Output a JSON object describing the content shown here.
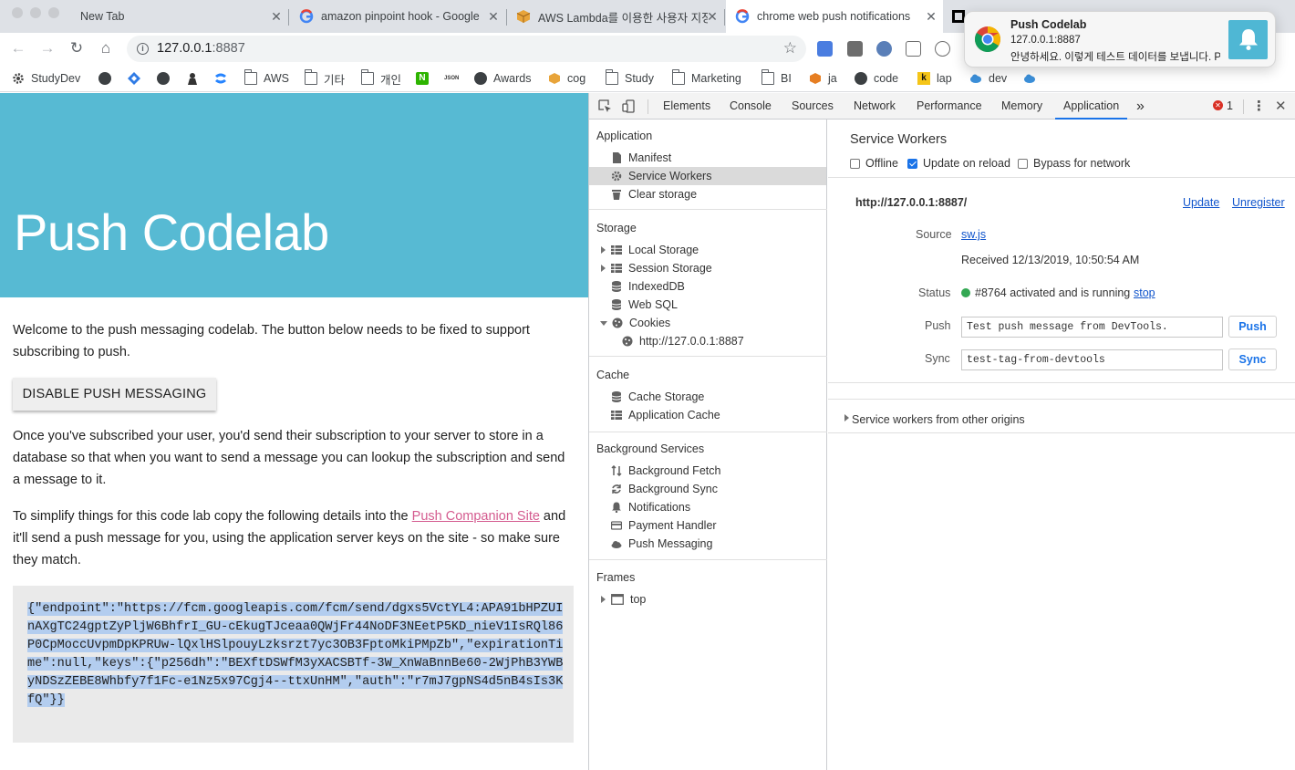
{
  "tabs": [
    {
      "title": "New Tab"
    },
    {
      "title": "amazon pinpoint hook - Google"
    },
    {
      "title": "AWS Lambda를 이용한 사용자 지정"
    },
    {
      "title": "chrome web push notifications"
    }
  ],
  "toolbar": {
    "url_host": "127.0.0.1",
    "url_port": ":8887"
  },
  "bookmarks": [
    {
      "label": "StudyDev"
    },
    {
      "label": "AWS"
    },
    {
      "label": "기타"
    },
    {
      "label": "개인"
    },
    {
      "label": "Awards"
    },
    {
      "label": "cog"
    },
    {
      "label": "Study"
    },
    {
      "label": "Marketing"
    },
    {
      "label": "BI"
    },
    {
      "label": "ja"
    },
    {
      "label": "code"
    },
    {
      "label": "lap"
    },
    {
      "label": "dev"
    }
  ],
  "bookmark_icon_text": {
    "n": "N",
    "json": "JSON",
    "k": "k"
  },
  "page": {
    "title": "Push Codelab",
    "intro": "Welcome to the push messaging codelab. The button below needs to be fixed to support subscribing to push.",
    "button_label": "DISABLE PUSH MESSAGING",
    "para2": "Once you've subscribed your user, you'd send their subscription to your server to store in a database so that when you want to send a message you can lookup the subscription and send a message to it.",
    "para3_before": "To simplify things for this code lab copy the following details into the ",
    "para3_link": "Push Companion Site",
    "para3_after": " and it'll send a push message for you, using the application server keys on the site - so make sure they match.",
    "subscription_json": "{\"endpoint\":\"https://fcm.googleapis.com/fcm/send/dgxs5VctYL4:APA91bHPZUInAXgTC24gptZyPljW6BhfrI_GU-cEkugTJceaa0QWjFr44NoDF3NEetP5KD_nieV1IsRQl86P0CpMoccUvpmDpKPRUw-lQxlHSlpouyLzksrzt7yc3OB3FptoMkiPMpZb\",\"expirationTime\":null,\"keys\":{\"p256dh\":\"BEXftDSWfM3yXACSBTf-3W_XnWaBnnBe60-2WjPhB3YWByNDSzZEBE8Whbfy7f1Fc-e1Nz5x97Cgj4--ttxUnHM\",\"auth\":\"r7mJ7gpNS4d5nB4sIs3KfQ\"}}"
  },
  "devtools": {
    "tabs": [
      "Elements",
      "Console",
      "Sources",
      "Network",
      "Performance",
      "Memory",
      "Application"
    ],
    "active_tab": "Application",
    "more": "»",
    "error_count": "1",
    "sidebar": {
      "application": {
        "title": "Application",
        "items": [
          "Manifest",
          "Service Workers",
          "Clear storage"
        ]
      },
      "storage": {
        "title": "Storage",
        "items": [
          "Local Storage",
          "Session Storage",
          "IndexedDB",
          "Web SQL",
          "Cookies",
          "http://127.0.0.1:8887"
        ]
      },
      "cache": {
        "title": "Cache",
        "items": [
          "Cache Storage",
          "Application Cache"
        ]
      },
      "background": {
        "title": "Background Services",
        "items": [
          "Background Fetch",
          "Background Sync",
          "Notifications",
          "Payment Handler",
          "Push Messaging"
        ]
      },
      "frames": {
        "title": "Frames",
        "items": [
          "top"
        ]
      }
    },
    "sw": {
      "title": "Service Workers",
      "offline": "Offline",
      "update_on_reload": "Update on reload",
      "bypass": "Bypass for network",
      "origin": "http://127.0.0.1:8887/",
      "update": "Update",
      "unregister": "Unregister",
      "source_label": "Source",
      "source_file": "sw.js",
      "received": "Received 12/13/2019, 10:50:54 AM",
      "status_label": "Status",
      "status_text": "#8764 activated and is running",
      "stop": "stop",
      "push_label": "Push",
      "push_value": "Test push message from DevTools.",
      "push_button": "Push",
      "sync_label": "Sync",
      "sync_value": "test-tag-from-devtools",
      "sync_button": "Sync",
      "other_origins": "Service workers from other origins"
    }
  },
  "notification": {
    "title": "Push Codelab",
    "origin": "127.0.0.1:8887",
    "body": "안녕하세요. 이렇게 테스트 데이터를 보냅니다. Pi..."
  },
  "colors": {
    "hero": "#57bad3",
    "link_pink": "#d45b8f",
    "devtools_accent": "#1a73e8",
    "status_green": "#34a853",
    "selection": "#b3cdef"
  }
}
